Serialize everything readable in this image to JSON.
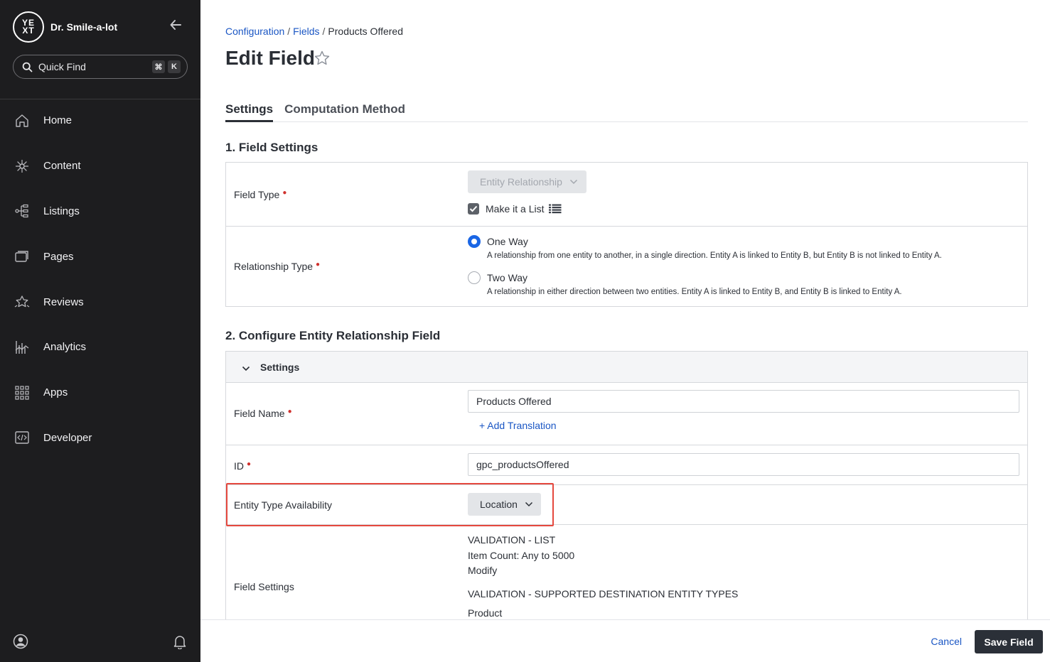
{
  "sidebar": {
    "logo_text_top": "YE",
    "logo_text_bottom": "XT",
    "account_name": "Dr. Smile-a-lot",
    "quick_find": {
      "label": "Quick Find",
      "shortcut_mod": "⌘",
      "shortcut_key": "K"
    },
    "items": [
      {
        "label": "Home",
        "icon": "home-icon"
      },
      {
        "label": "Content",
        "icon": "content-icon"
      },
      {
        "label": "Listings",
        "icon": "listings-icon"
      },
      {
        "label": "Pages",
        "icon": "pages-icon"
      },
      {
        "label": "Reviews",
        "icon": "reviews-icon"
      },
      {
        "label": "Analytics",
        "icon": "analytics-icon"
      },
      {
        "label": "Apps",
        "icon": "apps-icon"
      },
      {
        "label": "Developer",
        "icon": "developer-icon"
      }
    ]
  },
  "breadcrumb": {
    "first": "Configuration",
    "second": "Fields",
    "current": "Products Offered",
    "separator": "/"
  },
  "page": {
    "title": "Edit Field"
  },
  "tabs": [
    {
      "label": "Settings",
      "active": true
    },
    {
      "label": "Computation Method",
      "active": false
    }
  ],
  "section1": {
    "title": "1. Field Settings",
    "field_type": {
      "label": "Field Type",
      "value": "Entity Relationship",
      "make_list_label": "Make it a List",
      "make_list_checked": true
    },
    "relationship_type": {
      "label": "Relationship Type",
      "options": [
        {
          "title": "One Way",
          "desc": "A relationship from one entity to another, in a single direction. Entity A is linked to Entity B, but Entity B is not linked to Entity A.",
          "checked": true
        },
        {
          "title": "Two Way",
          "desc": "A relationship in either direction between two entities. Entity A is linked to Entity B, and Entity B is linked to Entity A.",
          "checked": false
        }
      ]
    }
  },
  "section2": {
    "title": "2. Configure Entity Relationship Field",
    "subheader": "Settings",
    "field_name": {
      "label": "Field Name",
      "value": "Products Offered",
      "add_translation": "+ Add Translation"
    },
    "id": {
      "label": "ID",
      "value": "gpc_productsOffered"
    },
    "entity_type_availability": {
      "label": "Entity Type Availability",
      "value": "Location"
    },
    "field_settings": {
      "label": "Field Settings",
      "validation_list_heading": "VALIDATION - LIST",
      "item_count": "Item Count: Any to 5000",
      "modify": "Modify",
      "validation_types_heading": "VALIDATION - SUPPORTED DESTINATION ENTITY TYPES",
      "entity_type": "Product"
    }
  },
  "footer": {
    "cancel": "Cancel",
    "save": "Save Field"
  },
  "colors": {
    "accent": "#1a66e5",
    "link": "#1a56c4",
    "sidebar_bg": "#1d1d1f",
    "required": "#d0312d",
    "highlight": "#e5483e",
    "primary_button": "#2b3038"
  }
}
